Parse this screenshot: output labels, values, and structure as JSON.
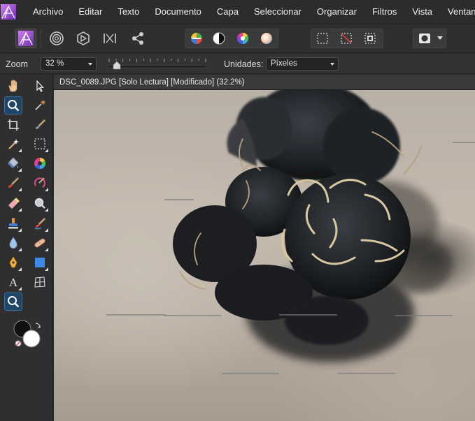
{
  "menu": {
    "items": [
      "Archivo",
      "Editar",
      "Texto",
      "Documento",
      "Capa",
      "Seleccionar",
      "Organizar",
      "Filtros",
      "Vista",
      "Ventana"
    ]
  },
  "context": {
    "zoom_label": "Zoom",
    "zoom_value": "32 %",
    "zoom_slider_level": 0.08,
    "units_label": "Unidades:",
    "units_value": "Píxeles"
  },
  "document": {
    "tab_title": "DSC_0089.JPG [Solo Lectura] [Modificado] (32.2%)"
  },
  "tools": {
    "left": [
      "hand-icon",
      "zoom-icon",
      "crop-icon",
      "magic-wand-icon",
      "fill-bucket-icon",
      "paint-brush-icon",
      "eraser-icon",
      "clone-stamp-icon",
      "blur-drop-icon",
      "pen-icon",
      "text-icon",
      "zoom-icon"
    ],
    "right": [
      "move-arrow-icon",
      "color-picker-icon",
      "brush-selection-icon",
      "marquee-icon",
      "color-wheel-icon",
      "red-eye-icon",
      "magnifier-icon",
      "smudge-icon",
      "patch-icon",
      "shape-rect-icon",
      "mesh-warp-icon"
    ]
  },
  "colors": {
    "accent": "#9b4cd0",
    "active_tool": "#1f4567",
    "canvas_bg": "#1e1e1e"
  }
}
